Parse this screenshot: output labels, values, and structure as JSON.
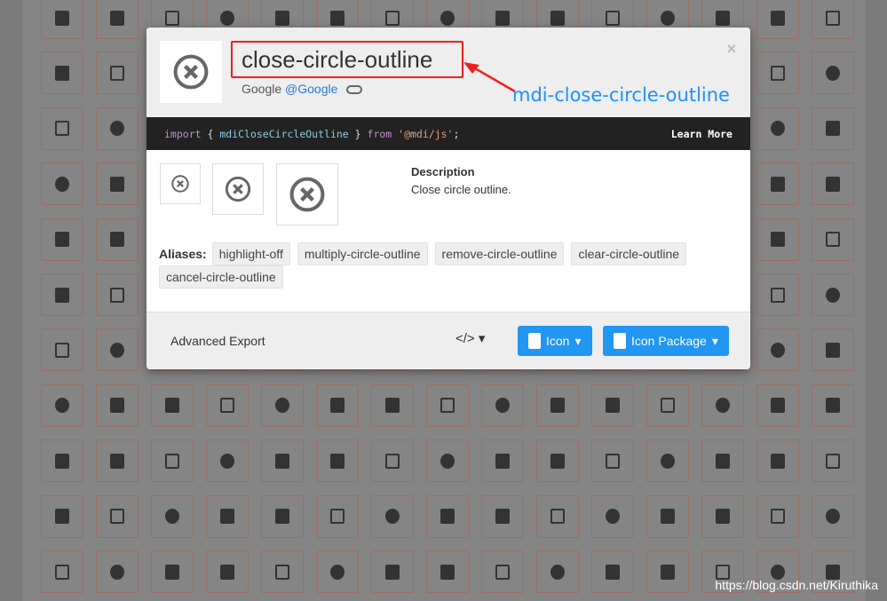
{
  "icon": {
    "name": "close-circle-outline",
    "author": "Google",
    "author_link": "@Google",
    "annotation": "mdi-close-circle-outline",
    "code": {
      "kw1": "import",
      "open": " { ",
      "ident": "mdiCloseCircleOutline",
      "close": " } ",
      "kw2": "from",
      "str": " '@mdi/js'",
      "end": ";"
    },
    "learn_more": "Learn More",
    "description_label": "Description",
    "description": "Close circle outline.",
    "aliases_label": "Aliases:",
    "aliases": [
      "highlight-off",
      "multiply-circle-outline",
      "remove-circle-outline",
      "clear-circle-outline",
      "cancel-circle-outline"
    ]
  },
  "footer": {
    "advanced_export": "Advanced Export",
    "code_menu": "</>",
    "icon_button": "Icon",
    "package_button": "Icon Package"
  },
  "close_symbol": "×",
  "watermark": "https://blog.csdn.net/Kiruthika",
  "colors": {
    "accent": "#2196f3",
    "annotation": "#f02020",
    "link": "#2a7ad6"
  }
}
